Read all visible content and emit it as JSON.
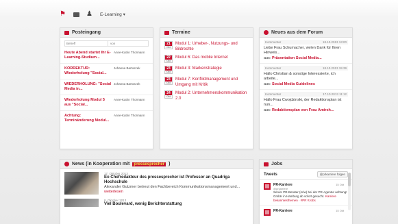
{
  "nav": {
    "home_icon": "home-icon",
    "mail_icon": "mail-icon",
    "profile_icon": "person-icon",
    "elearning_label": "E-Learning",
    "elearning_caret": "▾"
  },
  "posteingang": {
    "title": "Posteingang",
    "col_subject": "Betreff",
    "col_from": "von",
    "messages": [
      {
        "subject": "Heute Abend startet Ihr E-Learning-Studium...",
        "from": "Anne-Katrin Thormann"
      },
      {
        "subject": "KORREKTUR: Wiederholung \"Social...",
        "from": "Johanna Bartoszek"
      },
      {
        "subject": "WIEDERHOLUNG: \"Social Media in...",
        "from": "Johanna Bartoszek"
      },
      {
        "subject": "Wiederholung Modul 5 aus \"Social...",
        "from": "Anne-Katrin Thormann"
      },
      {
        "subject": "Achtung: Terminänderung Modul...",
        "from": "Anne-Katrin Thormann"
      }
    ]
  },
  "termine": {
    "title": "Termine",
    "items": [
      {
        "day": "21",
        "weekday": "Okt",
        "text": "Modul 1: Urheber-, Nutzungs- und Bildrechte"
      },
      {
        "day": "22",
        "weekday": "Okt",
        "text": "Modul 6: Das mobile Internet"
      },
      {
        "day": "23",
        "weekday": "Okt",
        "text": "Modul 3: Markenstrategie"
      },
      {
        "day": "23",
        "weekday": "Okt",
        "text": "Modul 7: Konfliktmanagement und Umgang mit Kritik"
      },
      {
        "day": "24",
        "weekday": "Okt",
        "text": "Modul 2: Unternehmenskommunikation 2.0"
      }
    ]
  },
  "forum": {
    "title": "Neues aus dem Forum",
    "posts": [
      {
        "meta_left": "Kommentar",
        "meta_right": "18.10.2013 13:00",
        "text": "Liebe Frau Schumacher, vielen Dank für Ihren Hinweis...",
        "link_prefix": "aus:",
        "link": "Präsentation Social Media..."
      },
      {
        "meta_left": "Kommentar",
        "meta_right": "18.10.2013 15:39",
        "text": "Hallo Christian & sonstige Interessierte, ich arbeite...",
        "link_prefix": "aus:",
        "link": "Social Media Guidelines"
      },
      {
        "meta_left": "Kommentar",
        "meta_right": "17.10.2013 11:12",
        "text": "Hallo Frau Cwojdzinski, der Redaktionsplan ist nun...",
        "link_prefix": "aus:",
        "link": "Redaktionsplan von Frau Amirsh..."
      }
    ]
  },
  "news": {
    "title_prefix": "News (in Kooperation mit",
    "title_brand": "pressesprecher",
    "title_suffix": ")",
    "items": [
      {
        "date": "17. Oktober 2013",
        "title": "Ex-Chefredakteur des pressesprecher ist Professor an Quadriga Hochschule",
        "body": "Alexander Gutzmer betreut den Fachbereich Kommunikationsmanagement und...",
        "more": "weiterlesen"
      },
      {
        "date": "8. Oktober 2013",
        "title": "Viel Boulevard, wenig Berichterstattung",
        "body": "",
        "more": ""
      }
    ]
  },
  "jobs": {
    "title": "Jobs",
    "tweets_label": "Tweets",
    "follow_label": "@prkarriere folgen",
    "tweets": [
      {
        "name": "PR-Karriere",
        "handle": "@prkarriere",
        "time": "15 Okt",
        "text": "Senior PR-Berater (m/w) bei der PR-Agentur achtung! GmbH in Hamburg ab sofort gesucht.",
        "link": "Karriere bekanntesthemen · #PR #Jobs"
      },
      {
        "name": "PR-Karriere",
        "handle": "",
        "time": "15 Okt",
        "text": "",
        "link": ""
      }
    ]
  },
  "colors": {
    "accent": "#c8102e",
    "highlight": "#f4e24a"
  }
}
